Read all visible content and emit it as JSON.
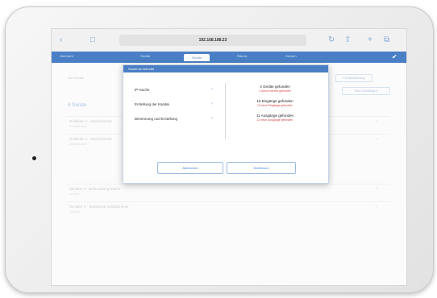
{
  "browser": {
    "url": "192.168.188.23",
    "back_icon": "chevron-left-icon",
    "bookmarks_icon": "book-icon",
    "refresh_icon": "refresh-icon",
    "share_icon": "share-icon",
    "new_tab_icon": "plus-icon",
    "tabs_icon": "tabs-icon"
  },
  "app_nav": {
    "items": [
      "Übersicht",
      "Geräte",
      "Räume",
      "Szenen"
    ],
    "active_tab": "Geräte"
  },
  "background": {
    "status_text": "Alle Geräte",
    "section_title": "4 Geräte",
    "buttons": [
      "Fernbedienung",
      "Neu hinzufügen"
    ],
    "rows": [
      {
        "title": "Rollladen 1 - Wohnzimmer",
        "sub": "Rollladenaktor"
      },
      {
        "title": "Rollladen 2 - Wohnzimmer",
        "sub": "Rollladenaktor"
      },
      {
        "title": "Schalter 1 - Beleuchtung Küche",
        "sub": "Schalter"
      },
      {
        "title": "Schalter 2 - Steckdose Schlafzimmer",
        "sub": "Schalter"
      }
    ]
  },
  "dialog": {
    "title": "Suche ist beendet",
    "steps": [
      {
        "label": "IP-Suche",
        "status": "✓"
      },
      {
        "label": "Erstellung der Kanäle",
        "status": "✓"
      },
      {
        "label": "Benennung und Erstellung",
        "status": "✓"
      }
    ],
    "results": [
      {
        "main": "4 Geräte gefunden",
        "sub": "4 davon bereits gefunden"
      },
      {
        "main": "16 Eingänge gefunden",
        "sub": "16 neue Eingänge gefunden"
      },
      {
        "main": "11 Ausgänge gefunden",
        "sub": "11 neue Ausgänge gefunden"
      }
    ],
    "buttons": {
      "cancel": "Abbrechen",
      "finish": "Schliessen"
    }
  },
  "colors": {
    "accent": "#4a7fc5",
    "error": "#d94444"
  }
}
